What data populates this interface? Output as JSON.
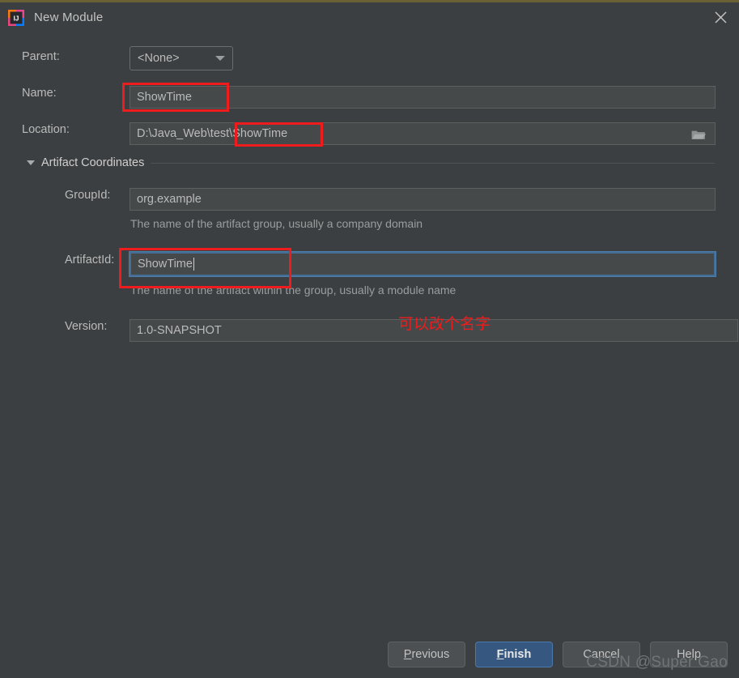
{
  "window": {
    "title": "New Module",
    "app_icon": "intellij-idea-icon",
    "close_icon": "close-icon",
    "border_accent_color": "#6b6034",
    "background_color": "#3c3f41"
  },
  "form": {
    "parent": {
      "label": "Parent:",
      "value": "<None>",
      "icon": "chevron-down-icon"
    },
    "name": {
      "label": "Name:",
      "value": "ShowTime"
    },
    "location": {
      "label": "Location:",
      "value": "D:\\Java_Web\\test\\ShowTime",
      "browse_icon": "folder-icon"
    }
  },
  "artifact_section": {
    "title": "Artifact Coordinates",
    "expanded": true,
    "collapse_icon": "triangle-down-icon",
    "group_id": {
      "label": "GroupId:",
      "value": "org.example",
      "hint": "The name of the artifact group, usually a company domain"
    },
    "artifact_id": {
      "label": "ArtifactId:",
      "value": "ShowTime",
      "hint": "The name of the artifact within the group, usually a module name",
      "focused": true
    },
    "version": {
      "label": "Version:",
      "value": "1.0-SNAPSHOT"
    }
  },
  "annotations": {
    "color": "#ee1c1c",
    "note_text": "可以改个名字",
    "boxes": [
      {
        "name": "name-field-highlight"
      },
      {
        "name": "location-suffix-highlight"
      },
      {
        "name": "artifact-id-highlight"
      }
    ]
  },
  "footer": {
    "previous": {
      "label": "Previous",
      "mnemonic": "P"
    },
    "finish": {
      "label": "Finish",
      "mnemonic": "F",
      "default": true,
      "color": "#365880"
    },
    "cancel": {
      "label": "Cancel"
    },
    "help": {
      "label": "Help"
    }
  },
  "watermark": "CSDN @Super Gao"
}
